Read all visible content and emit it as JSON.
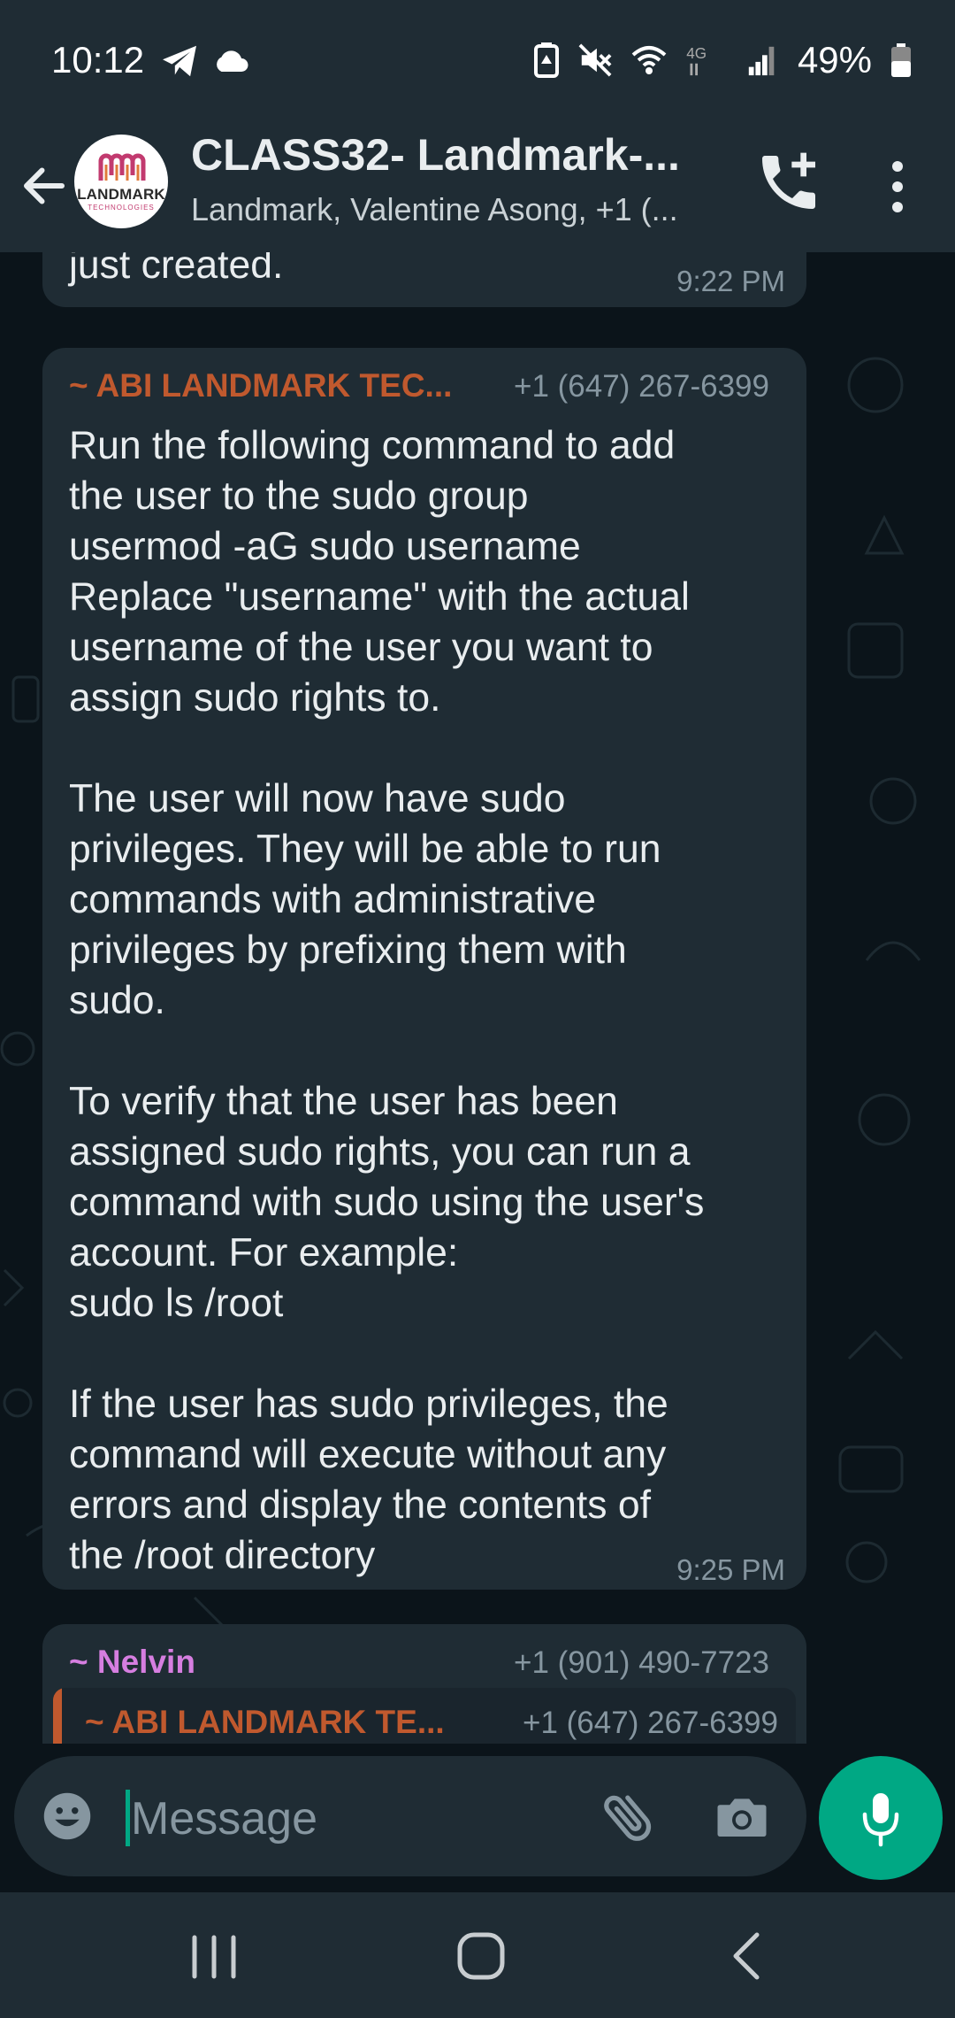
{
  "status_bar": {
    "time": "10:12",
    "battery": "49%",
    "icons": [
      "telegram-icon",
      "cloud-icon",
      "battery-saver-icon",
      "mute-icon",
      "wifi-icon",
      "network-4g-icon",
      "signal-icon",
      "battery-icon"
    ]
  },
  "header": {
    "title": "CLASS32- Landmark-...",
    "subtitle": "Landmark, Valentine Asong, +1 (...",
    "avatar_text": "LANDMARK",
    "avatar_subtext": "TECHNOLOGIES"
  },
  "messages": [
    {
      "text": "just created.",
      "time": "9:22 PM"
    },
    {
      "sender": "~ ABI LANDMARK TEC...",
      "phone": "+1 (647) 267-6399",
      "text": "Run the following command to add\nthe user to the sudo group\nusermod -aG sudo username\nReplace \"username\" with the actual\nusername of the user you want to\nassign sudo rights to.\n\nThe user will now have sudo\nprivileges. They will be able to run\ncommands with administrative\nprivileges by prefixing them with\nsudo.\n\nTo verify that the user has been\nassigned sudo rights, you can run a\ncommand with sudo using the user's\naccount. For example:\nsudo ls /root\n\nIf the user has sudo privileges, the\ncommand will execute without any\nerrors and display the contents of\nthe /root directory",
      "time": "9:25 PM"
    },
    {
      "sender": "~ Nelvin",
      "phone": "+1 (901) 490-7723",
      "quoted_sender": "~ ABI LANDMARK TE...",
      "quoted_phone": "+1 (647) 267-6399"
    }
  ],
  "input": {
    "placeholder": "Message"
  },
  "colors": {
    "accent": "#00a884",
    "sender_abi": "#c0592e",
    "sender_nelvin": "#d67ee0",
    "bubble": "#1f2c34",
    "background": "#0b141a"
  }
}
